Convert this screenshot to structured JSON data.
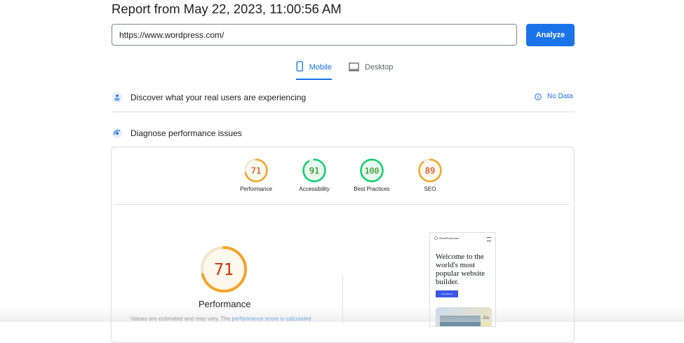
{
  "report": {
    "title": "Report from May 22, 2023, 11:00:56 AM"
  },
  "url_input": {
    "value": "https://www.wordpress.com/",
    "button": "Analyze"
  },
  "tabs": {
    "mobile": "Mobile",
    "desktop": "Desktop"
  },
  "field_section": {
    "label": "Discover what your real users are experiencing",
    "status": "No Data"
  },
  "lab_section": {
    "label": "Diagnose performance issues"
  },
  "scores": [
    {
      "label": "Performance",
      "value": 71,
      "color": "#f4a52a",
      "fill": "#fff8ec",
      "text_color": "#c33300"
    },
    {
      "label": "Accessibility",
      "value": 91,
      "color": "#0cce6b",
      "fill": "#e9f8ee",
      "text_color": "#008800"
    },
    {
      "label": "Best Practices",
      "value": 100,
      "color": "#0cce6b",
      "fill": "#e9f8ee",
      "text_color": "#008800"
    },
    {
      "label": "SEO",
      "value": 89,
      "color": "#f4a52a",
      "fill": "#fff8ec",
      "text_color": "#c33300"
    }
  ],
  "detail": {
    "score": 71,
    "label": "Performance",
    "note_prefix": "Values are estimated and may vary. The ",
    "note_link": "performance score is calculated"
  },
  "screenshot": {
    "logo": "WordPress.com",
    "headline": "Welcome to the world's most popular website builder.",
    "button": "Get started",
    "card_text": "Aa"
  }
}
